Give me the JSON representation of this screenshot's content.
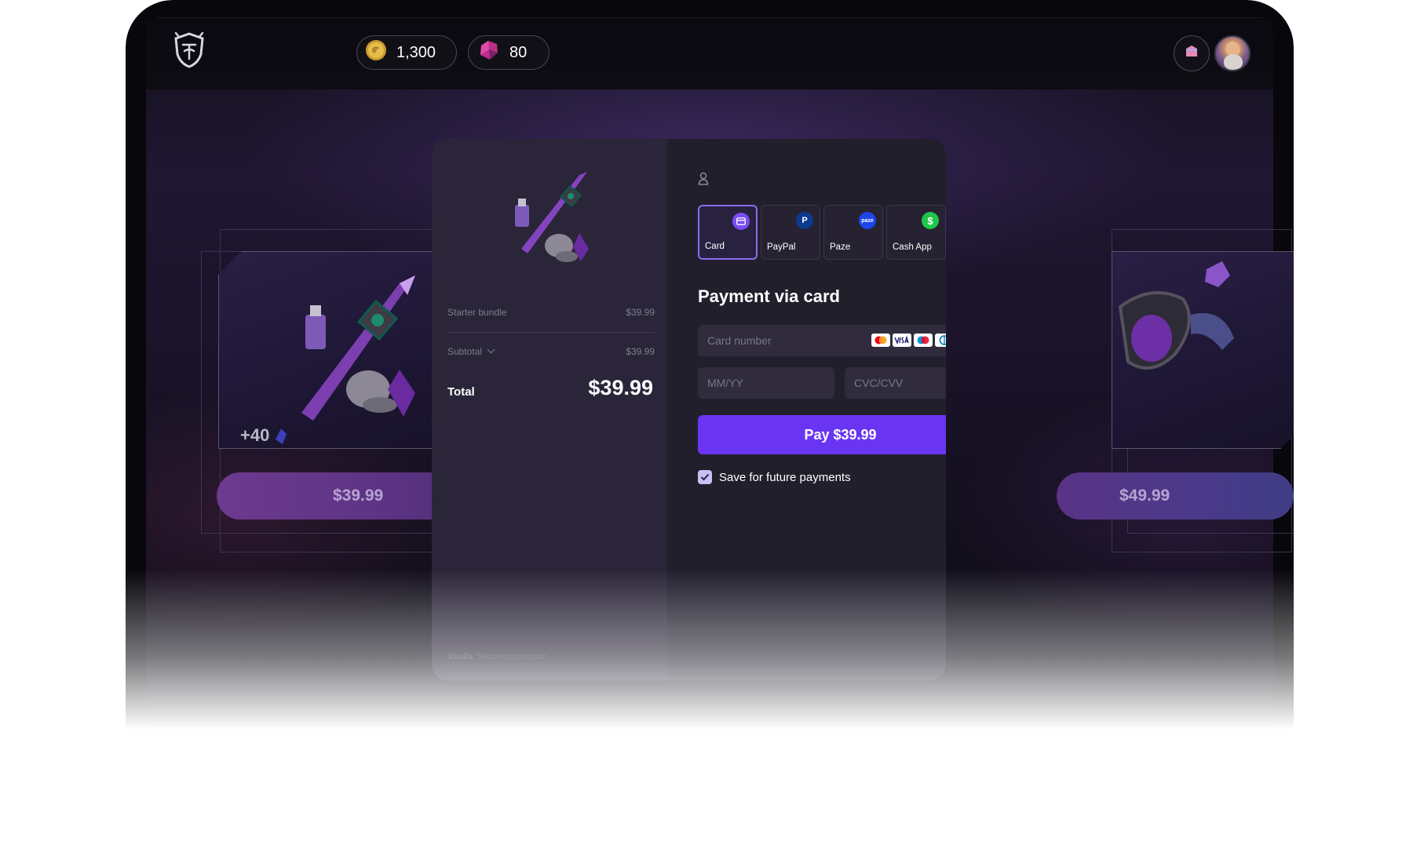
{
  "topbar": {
    "coins": "1,300",
    "gems": "80",
    "icons": [
      "shield-logo-icon",
      "coin-icon",
      "gem-icon",
      "shop-icon",
      "avatar"
    ]
  },
  "offers": {
    "left": {
      "bonus": "+40",
      "price": "$39.99"
    },
    "right": {
      "price": "$49.99"
    }
  },
  "summary": {
    "item_name": "Starter bundle",
    "item_price": "$39.99",
    "subtotal_label": "Subtotal",
    "subtotal_value": "$39.99",
    "total_label": "Total",
    "total_value": "$39.99",
    "footer_brand": "Xsolla",
    "footer_text": "Secure connection"
  },
  "payment": {
    "methods": [
      {
        "label": "Card",
        "icon": "card-icon",
        "color": "#7b4cf5",
        "active": true
      },
      {
        "label": "PayPal",
        "icon": "paypal-icon",
        "color": "#0b3a8f",
        "active": false
      },
      {
        "label": "Paze",
        "icon": "paze-icon",
        "color": "#1b46e8",
        "active": false
      },
      {
        "label": "Cash App",
        "icon": "cash-app-icon",
        "color": "#1fc649",
        "active": false
      }
    ],
    "more_label": "...",
    "title": "Payment via card",
    "card_number_placeholder": "Card number",
    "expiry_placeholder": "MM/YY",
    "cvc_placeholder": "CVC/CVV",
    "pay_label": "Pay $39.99",
    "save_label": "Save for future payments",
    "save_checked": true
  },
  "colors": {
    "accent": "#6a35f2",
    "modal_left": "#2a2538",
    "modal_right": "#221f2d"
  }
}
